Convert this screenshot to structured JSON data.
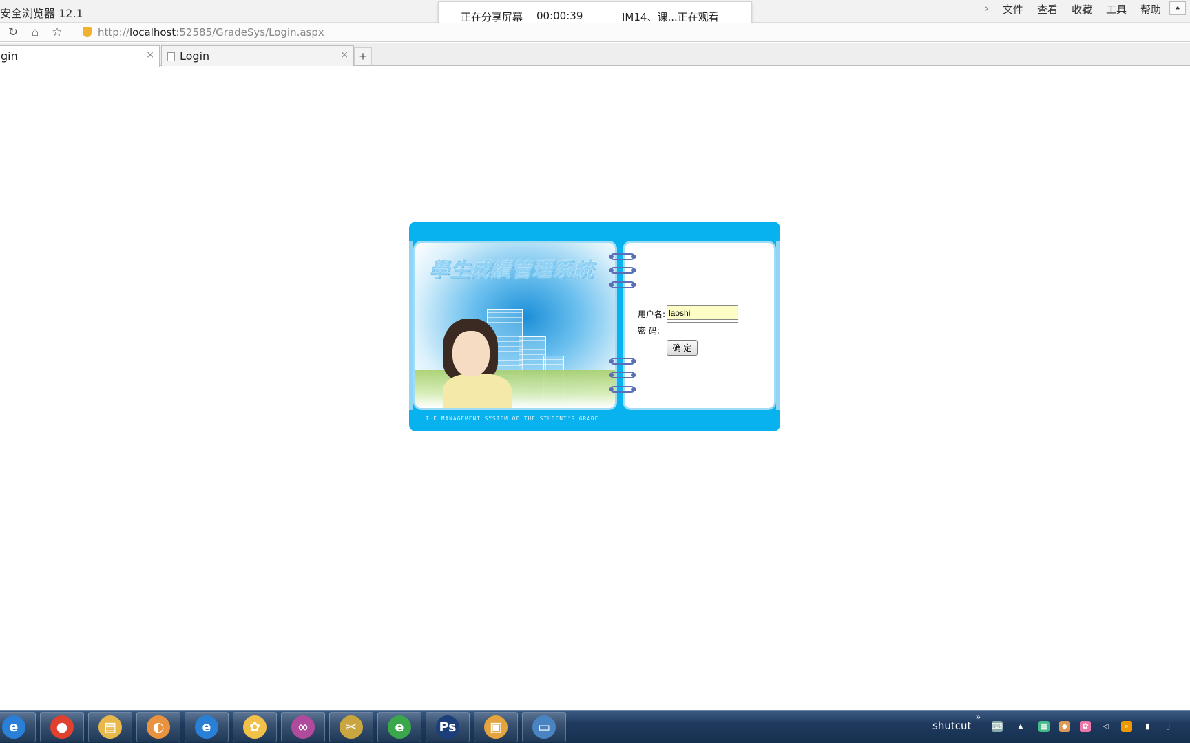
{
  "browser": {
    "app_title": "安全浏览器 12.1",
    "menu": [
      "文件",
      "查看",
      "收藏",
      "工具",
      "帮助"
    ],
    "url_prefix": "http://",
    "url_host": "localhost",
    "url_rest": ":52585/GradeSys/Login.aspx",
    "tabs": [
      {
        "label": "gin"
      },
      {
        "label": "Login"
      }
    ],
    "new_tab": "+",
    "tab_close": "×"
  },
  "share": {
    "status": "正在分享屏幕",
    "elapsed": "00:00:39",
    "viewer": "IM14、课...正在观看"
  },
  "login": {
    "system_title": "學生成績管理系統",
    "footer": "THE MANAGEMENT SYSTEM OF THE STUDENT'S GRADE",
    "username_label": "用户名:",
    "username_value": "laoshi",
    "password_label": "密  码:",
    "password_value": "",
    "submit_label": "确 定"
  },
  "taskbar": {
    "tray_label": "shutcut",
    "tray_more": "»",
    "apps": [
      {
        "name": "ie-icon",
        "glyph": "e",
        "color": "#2a7fd6"
      },
      {
        "name": "chrome-icon",
        "glyph": "●",
        "color": "#e0412f"
      },
      {
        "name": "folder-icon",
        "glyph": "▤",
        "color": "#e8b84a"
      },
      {
        "name": "speaker-icon",
        "glyph": "◐",
        "color": "#e99240"
      },
      {
        "name": "ie-icon-2",
        "glyph": "e",
        "color": "#2a7fd6"
      },
      {
        "name": "qq-icon",
        "glyph": "✿",
        "color": "#f2c14a"
      },
      {
        "name": "visual-studio-icon",
        "glyph": "∞",
        "color": "#b04a9c"
      },
      {
        "name": "tools-icon",
        "glyph": "✂",
        "color": "#c9a640"
      },
      {
        "name": "browser-e-icon",
        "glyph": "e",
        "color": "#3aa84a"
      },
      {
        "name": "photoshop-icon",
        "glyph": "Ps",
        "color": "#1c3e7a"
      },
      {
        "name": "package-icon",
        "glyph": "▣",
        "color": "#e4a440"
      },
      {
        "name": "window-icon",
        "glyph": "▭",
        "color": "#4a83c2"
      }
    ]
  }
}
